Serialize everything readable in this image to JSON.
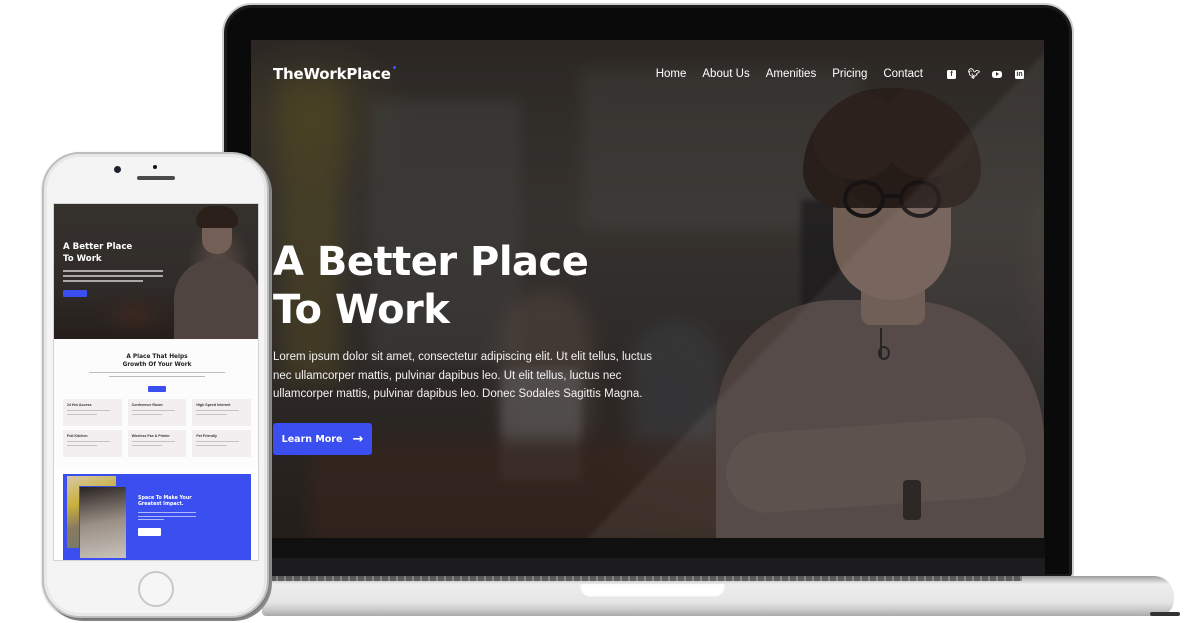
{
  "laptop_site": {
    "logo": "TheWorkPlace",
    "nav": [
      "Home",
      "About Us",
      "Amenities",
      "Pricing",
      "Contact"
    ],
    "social_icons": [
      "facebook-icon",
      "twitter-icon",
      "youtube-icon",
      "linkedin-icon"
    ],
    "hero": {
      "title_line1": "A Better Place",
      "title_line2": "To Work",
      "text": "Lorem ipsum dolor sit amet, consectetur adipiscing elit. Ut elit tellus, luctus nec ullamcorper mattis, pulvinar dapibus leo. Ut elit tellus, luctus nec ullamcorper mattis, pulvinar dapibus leo. Donec Sodales Sagittis Magna.",
      "button_label": "Learn More",
      "button_icon": "arrow-right-icon"
    }
  },
  "phone_site": {
    "hero": {
      "title_line1": "A Better Place",
      "title_line2": "To Work"
    },
    "section": {
      "title_line1": "A Place That Helps",
      "title_line2": "Growth Of Your Work",
      "cards": [
        {
          "title": "24 Hrs Access"
        },
        {
          "title": "Conference Room"
        },
        {
          "title": "High Speed Internet"
        },
        {
          "title": "Full Kitchen"
        },
        {
          "title": "Wireless Fax & Printer"
        },
        {
          "title": "Pet Friendly"
        }
      ]
    },
    "banner": {
      "title_line1": "Space To Make Your",
      "title_line2": "Greatest Impact."
    }
  },
  "colors": {
    "accent": "#3b4ef0",
    "text_on_dark": "#ffffff"
  }
}
